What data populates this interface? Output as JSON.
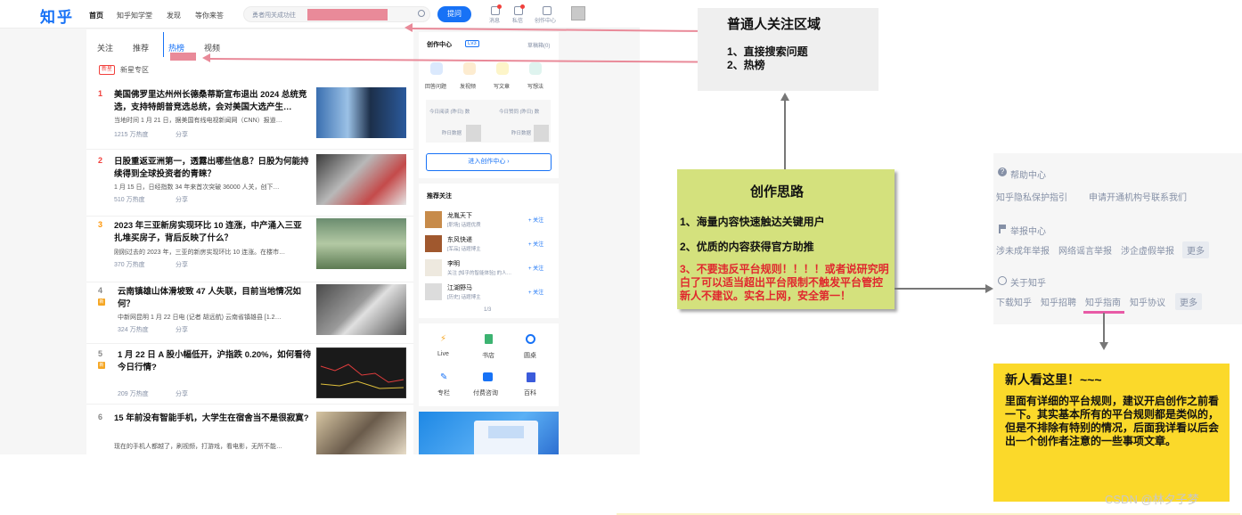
{
  "zhihu": {
    "logo": "知乎",
    "nav": [
      "首页",
      "知乎知学堂",
      "发现",
      "等你来答"
    ],
    "search_placeholder": "勇者闯关成功往",
    "ask_button": "提问",
    "top_icons": [
      "消息",
      "私信",
      "创作中心"
    ],
    "feed_tabs": [
      "关注",
      "推荐",
      "热榜",
      "视频"
    ],
    "hot_tag": "新星",
    "hot_zone": "新星专区",
    "hot_items": [
      {
        "rank": "1",
        "title": "美国佛罗里达州州长德桑蒂斯宣布退出 2024 总统竞选，支持特朗普竞选总统，会对美国大选产生…",
        "excerpt": "当地时间 1 月 21 日，据美国有线电视新闻网（CNN）报道…",
        "heat": "1215 万热度",
        "share": "分享"
      },
      {
        "rank": "2",
        "title": "日股重返亚洲第一，透露出哪些信息？日股为何能持续得到全球投资者的青睐？",
        "excerpt": "1 月 15 日，日经指数 34 年来首次突破 36000 人关，创下…",
        "heat": "510 万热度",
        "share": "分享"
      },
      {
        "rank": "3",
        "title": "2023 年三亚新房实现环比 10 连涨，中产涌入三亚扎堆买房子，背后反映了什么？",
        "excerpt": "刚刚过去的 2023 年，三亚的新房实现环比 10 连涨。在楼市…",
        "heat": "370 万热度",
        "share": "分享"
      },
      {
        "rank": "4",
        "title": "云南镇雄山体滑坡致 47 人失联，目前当地情况如何？",
        "excerpt": "中新网昆明 1 月 22 日电 (记者 胡远航) 云南省镇雄县 [1.2…",
        "heat": "324 万热度",
        "share": "分享"
      },
      {
        "rank": "5",
        "title": "1 月 22 日 A 股小幅低开，沪指跌 0.20%，如何看待今日行情?",
        "excerpt": "",
        "heat": "209 万热度",
        "share": "分享"
      },
      {
        "rank": "6",
        "title": "15 年前没有智能手机，大学生在宿舍当不是很寂寞?",
        "excerpt": "现在的手机人都越了，刷视频，打游戏，看电影，无所不能…",
        "heat": "",
        "share": ""
      }
    ],
    "creator": {
      "title": "创作中心",
      "level": "Lv3",
      "drafts": "草稿箱(0)",
      "actions": [
        "回答问题",
        "发视频",
        "写文章",
        "写想法"
      ],
      "stat1": "今日阅读 (昨日) 数",
      "stat2": "今日赞同 (昨日) 数",
      "sub1": "昨日数据",
      "sub2": "昨日数据",
      "enter": "进入创作中心 ›"
    },
    "recommend": {
      "title": "推荐关注",
      "people": [
        {
          "name": "龙胤天下",
          "desc": "[职场] 话题优质",
          "follow": "+ 关注"
        },
        {
          "name": "东风快递",
          "desc": "[军品] 话题博主",
          "follow": "+ 关注"
        },
        {
          "name": "李明",
          "desc": "关注 [知乎的智能体验] 的人…",
          "follow": "+ 关注"
        },
        {
          "name": "江湖野马",
          "desc": "[历史] 话题博主",
          "follow": "+ 关注"
        }
      ],
      "pager": "1/3"
    },
    "quick": [
      "Live",
      "书店",
      "圆桌",
      "专栏",
      "付费咨询",
      "百科"
    ]
  },
  "annotations": {
    "box1_title": "普通人关注区域",
    "box1_lines": [
      "1、直接搜索问题",
      "2、热榜"
    ],
    "box2_title": "创作思路",
    "box2_lines": [
      "1、海量内容快速触达关键用户",
      "2、优质的内容获得官方助推"
    ],
    "box2_warning": "3、不要违反平台规则！！！！或者说研究明白了可以适当超出平台限制不触发平台管控新人不建议。实名上网，安全第一！",
    "box3_title": "新人看这里！~~~",
    "box3_text": "里面有详细的平台规则，建议开启创作之前看一下。其实基本所有的平台规则都是类似的，但是不排除有特别的情况，后面我详看以后会出一个创作者注意的一些事项文章。"
  },
  "help": {
    "h1": "帮助中心",
    "h1_links": [
      "知乎隐私保护指引",
      "申请开通机构号",
      "联系我们"
    ],
    "h2": "举报中心",
    "h2_links": [
      "涉未成年举报",
      "网络谣言举报",
      "涉企虚假举报"
    ],
    "h3": "关于知乎",
    "h3_links": [
      "下载知乎",
      "知乎招聘",
      "知乎指南",
      "知乎协议"
    ],
    "more": "更多"
  },
  "watermark": "CSDN @林夕子梦",
  "colors": {
    "brand": "#1772f6",
    "annot_arrow": "#e98a99",
    "green_box": "#d4e17d",
    "yellow_box": "#fbd92a",
    "gray_box": "#efefef"
  }
}
